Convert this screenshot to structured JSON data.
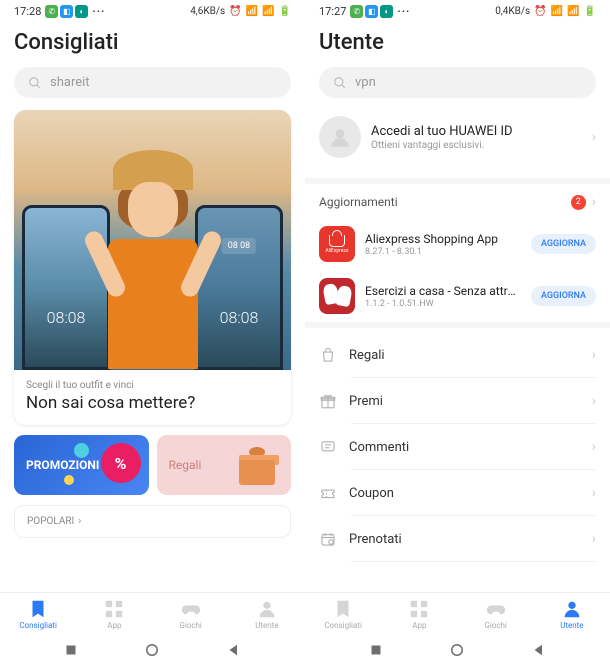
{
  "left": {
    "status": {
      "time": "17:28",
      "speed": "4,6KB/s"
    },
    "title": "Consigliati",
    "search": "shareit",
    "hero": {
      "sub": "Scegli il tuo outfit e vinci",
      "title": "Non sai cosa mettere?",
      "phone_time": "08:08",
      "phone_date": "08\n08"
    },
    "promos": [
      {
        "label": "PROMOZIONI"
      },
      {
        "label": "Regali"
      }
    ],
    "popular": "POPOLARI",
    "nav": [
      {
        "label": "Consigliati"
      },
      {
        "label": "App"
      },
      {
        "label": "Giochi"
      },
      {
        "label": "Utente"
      }
    ]
  },
  "right": {
    "status": {
      "time": "17:27",
      "speed": "0,4KB/s"
    },
    "title": "Utente",
    "search": "vpn",
    "account": {
      "title": "Accedi al tuo HUAWEI ID",
      "sub": "Ottieni vantaggi esclusivi."
    },
    "updates": {
      "title": "Aggiornamenti",
      "count": "2",
      "items": [
        {
          "name": "Aliexpress Shopping App",
          "ver": "8.27.1 - 8.30.1",
          "btn": "AGGIORNA"
        },
        {
          "name": "Esercizi a casa - Senza attrezzature",
          "ver": "1.1.2 - 1.0.51.HW",
          "btn": "AGGIORNA"
        }
      ]
    },
    "menu": [
      {
        "label": "Regali"
      },
      {
        "label": "Premi"
      },
      {
        "label": "Commenti"
      },
      {
        "label": "Coupon"
      },
      {
        "label": "Prenotati"
      }
    ],
    "nav": [
      {
        "label": "Consigliati"
      },
      {
        "label": "App"
      },
      {
        "label": "Giochi"
      },
      {
        "label": "Utente"
      }
    ]
  }
}
